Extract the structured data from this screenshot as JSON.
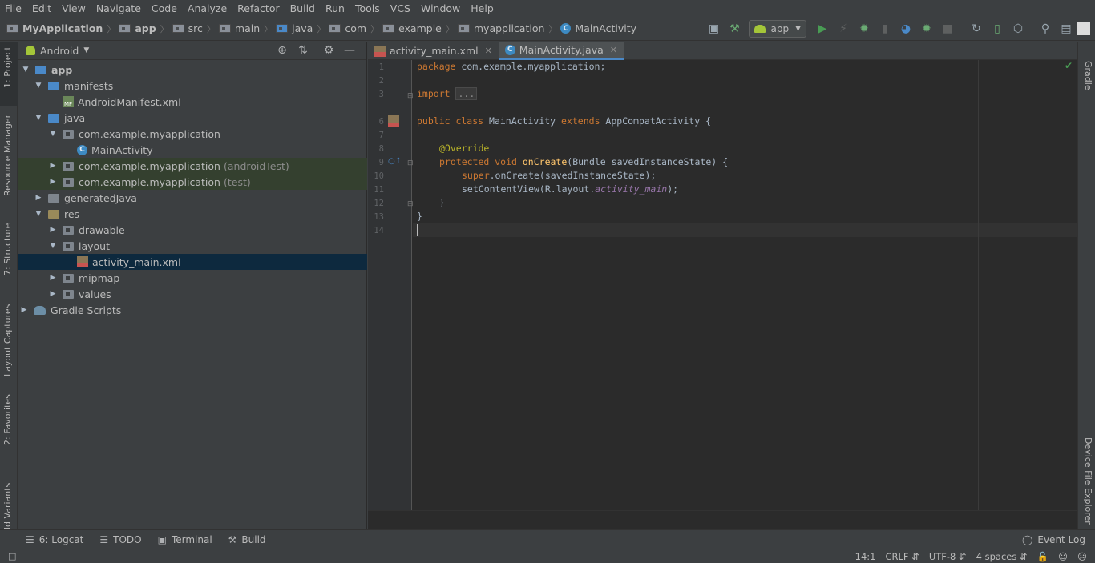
{
  "menu": [
    "File",
    "Edit",
    "View",
    "Navigate",
    "Code",
    "Analyze",
    "Refactor",
    "Build",
    "Run",
    "Tools",
    "VCS",
    "Window",
    "Help"
  ],
  "breadcrumb": {
    "project": "MyApplication",
    "module": "app",
    "items": [
      "src",
      "main",
      "java",
      "com",
      "example",
      "myapplication"
    ],
    "file": "MainActivity"
  },
  "run_config": "app",
  "project_panel": {
    "view": "Android",
    "tree": {
      "app": "app",
      "manifests": "manifests",
      "manifest_file": "AndroidManifest.xml",
      "java": "java",
      "pkg_main": "com.example.myapplication",
      "main_activity": "MainActivity",
      "pkg_android_test": "com.example.myapplication",
      "android_test_suffix": "(androidTest)",
      "pkg_test": "com.example.myapplication",
      "test_suffix": "(test)",
      "generated_java": "generatedJava",
      "res": "res",
      "drawable": "drawable",
      "layout": "layout",
      "layout_file": "activity_main.xml",
      "mipmap": "mipmap",
      "values": "values",
      "gradle_scripts": "Gradle Scripts"
    }
  },
  "left_strip": {
    "project": "1: Project",
    "resource_manager": "Resource Manager",
    "structure": "7: Structure",
    "layout_captures": "Layout Captures",
    "favorites": "2: Favorites",
    "build_variants": "ld Variants"
  },
  "right_strip": {
    "gradle": "Gradle",
    "device_file_explorer": "Device File Explorer"
  },
  "tabs": [
    {
      "label": "activity_main.xml"
    },
    {
      "label": "MainActivity.java"
    }
  ],
  "code": {
    "line_numbers": [
      "1",
      "2",
      "3",
      "6",
      "7",
      "8",
      "9",
      "10",
      "11",
      "12",
      "13",
      "14"
    ],
    "l1_kw": "package",
    "l1_rest": " com.example.myapplication;",
    "l3_kw": "import",
    "l3_fold": "...",
    "l6_kw1": "public class",
    "l6_name": " MainActivity ",
    "l6_kw2": "extends",
    "l6_rest": " AppCompatActivity {",
    "l7_ann": "@Override",
    "l8_kw": "protected void",
    "l8_fn": "onCreate",
    "l8_rest": "(Bundle savedInstanceState) {",
    "l9_kw": "super",
    "l9_rest": ".onCreate(savedInstanceState);",
    "l10_a": "setContentView(R.layout.",
    "l10_it": "activity_main",
    "l10_b": ");",
    "l11": "}",
    "l12": "}"
  },
  "bottom_tools": [
    "6: Logcat",
    "TODO",
    "Terminal",
    "Build"
  ],
  "event_log": "Event Log",
  "status": {
    "position": "14:1",
    "line_sep": "CRLF",
    "encoding": "UTF-8",
    "indent": "4 spaces"
  }
}
